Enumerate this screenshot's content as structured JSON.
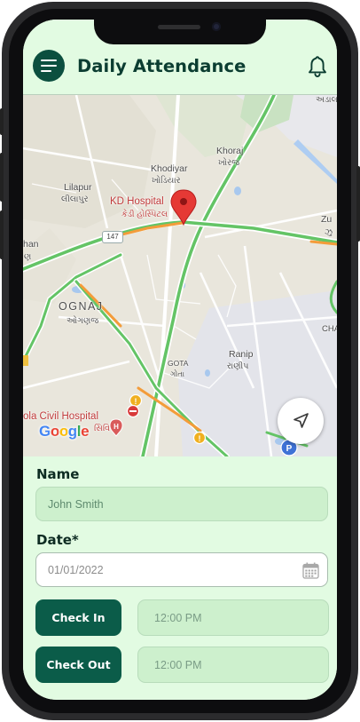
{
  "header": {
    "title": "Daily Attendance",
    "menu_icon": "hamburger-menu-icon",
    "notification_icon": "bell-icon"
  },
  "map": {
    "labels": {
      "khoraj": "Khoraj",
      "khoraj_gu": "ખોરજ",
      "khodiyar": "Khodiyar",
      "khodiyar_gu": "ખોડિયાર",
      "lilapur": "Lilapur",
      "lilapur_gu": "લીલાપુર",
      "kd_hospital": "KD Hospital",
      "kd_hospital_gu": "કેડી હોસ્પિટલ",
      "ognaj": "OGNAJ",
      "ognaj_gu": "ઓગણજ",
      "ranip": "Ranip",
      "ranip_gu": "રાણીપ",
      "gota": "GOTA",
      "gota_gu": "ગોતા",
      "civil_hospital": "ola Civil Hospital",
      "civil_hospital_gu": "સિવિ",
      "edge_top": "અડાલ",
      "edge_zu": "Zu",
      "edge_zu_gu": "ઝુ",
      "edge_han": "han",
      "edge_han_gu": "ણ",
      "edge_cha": "CHA",
      "highway": "147"
    },
    "attribution": "Google",
    "colors": {
      "attr_g": "#4285F4",
      "attr_o1": "#EA4335",
      "attr_o2": "#FBBC05",
      "attr_l": "#34A853"
    },
    "locate_button_icon": "navigation-arrow-icon"
  },
  "form": {
    "name_label": "Name",
    "name_value": "John Smith",
    "date_label": "Date*",
    "date_value": "01/01/2022",
    "calendar_icon": "calendar-icon",
    "check_in_label": "Check In",
    "check_in_time": "12:00 PM",
    "check_out_label": "Check Out",
    "check_out_time": "12:00 PM"
  },
  "colors": {
    "accent": "#0b5c49",
    "background": "#e2fbe2",
    "input_fill": "#cdf0cd",
    "title": "#0b3d31"
  }
}
